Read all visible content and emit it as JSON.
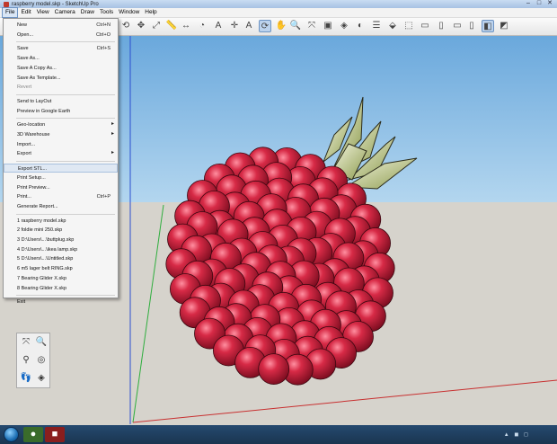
{
  "window": {
    "title": "raspberry model.skp - SketchUp Pro"
  },
  "window_buttons": [
    "–",
    "□",
    "✕"
  ],
  "menubar": [
    "File",
    "Edit",
    "View",
    "Camera",
    "Draw",
    "Tools",
    "Window",
    "Help"
  ],
  "file_menu": [
    {
      "label": "New",
      "shortcut": "Ctrl+N"
    },
    {
      "label": "Open...",
      "shortcut": "Ctrl+O"
    },
    {
      "sep": true
    },
    {
      "label": "Save",
      "shortcut": "Ctrl+S"
    },
    {
      "label": "Save As..."
    },
    {
      "label": "Save A Copy As..."
    },
    {
      "label": "Save As Template..."
    },
    {
      "label": "Revert",
      "disabled": true
    },
    {
      "sep": true
    },
    {
      "label": "Send to LayOut"
    },
    {
      "label": "Preview in Google Earth"
    },
    {
      "sep": true
    },
    {
      "label": "Geo-location",
      "submenu": true
    },
    {
      "label": "3D Warehouse",
      "submenu": true
    },
    {
      "label": "Import..."
    },
    {
      "label": "Export",
      "submenu": true
    },
    {
      "sep": true
    },
    {
      "label": "Export STL...",
      "highlighted": true
    },
    {
      "label": "Print Setup..."
    },
    {
      "label": "Print Preview..."
    },
    {
      "label": "Print...",
      "shortcut": "Ctrl+P"
    },
    {
      "label": "Generate Report..."
    },
    {
      "sep": true
    },
    {
      "label": "1 raspberry model.skp"
    },
    {
      "label": "2 foldie mini 250.skp"
    },
    {
      "label": "3 D:\\Users\\...\\buttplug.skp"
    },
    {
      "label": "4 D:\\Users\\...\\ikea lamp.skp"
    },
    {
      "label": "5 D:\\Users\\...\\Untitled.skp"
    },
    {
      "label": "6 m5 lager belt RING.skp"
    },
    {
      "label": "7 Bearing Glider X.skp"
    },
    {
      "label": "8 Bearing Glider X.skp"
    },
    {
      "sep": true
    },
    {
      "label": "Exit"
    }
  ],
  "toolbar_icons": [
    "rotate-icon",
    "move-icon",
    "scale-icon",
    "tape-measure-icon",
    "dimension-icon",
    "protractor-icon",
    "text-icon",
    "axes-icon",
    "3d-text-icon",
    "orbit-icon",
    "pan-icon",
    "zoom-icon",
    "zoom-extents-icon",
    "components-icon",
    "materials-icon",
    "styles-icon",
    "layers-icon",
    "iso-view-icon",
    "top-view-icon",
    "front-view-icon",
    "right-view-icon",
    "back-view-icon",
    "left-view-icon",
    "monochrome-icon",
    "shaded-icon"
  ],
  "side_tools": [
    "zoom-extents-icon",
    "magnify-icon",
    "position-camera-icon",
    "look-around-icon",
    "walk-icon",
    "section-plane-icon"
  ],
  "colors": {
    "sky_top": "#6aa8dc",
    "ground": "#d6d3cc",
    "berry": "#c4213a",
    "leaf": "#b7c48a",
    "taskbar": "#1f3d5e",
    "menu_highlight": "#dfe8f3"
  }
}
